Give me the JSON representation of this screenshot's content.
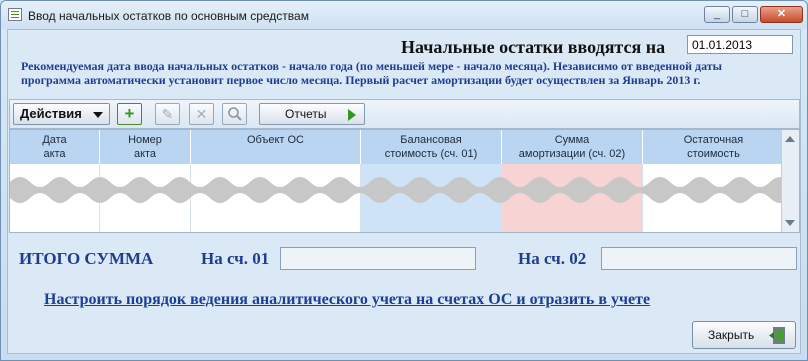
{
  "window": {
    "title": "Ввод начальных остатков по основным средствам",
    "controls": {
      "minimize": "_",
      "maximize": "□",
      "close": "✕"
    }
  },
  "header": {
    "start_label": "Начальные остатки вводятся на",
    "start_date": "01.01.2013",
    "note_line1": "Рекомендуемая дата ввода начальных остатков - начало года (по меньшей мере - начало месяца). Независимо от введенной даты",
    "note_line2": "программа автоматически установит первое число месяца. Первый расчет амортизации будет осуществлен за Январь 2013 г."
  },
  "toolbar": {
    "actions_label": "Действия",
    "add_icon": "plus-icon",
    "edit_icon": "pencil-icon",
    "delete_icon": "x-icon",
    "search_icon": "magnifier-icon",
    "reports_label": "Отчеты"
  },
  "table": {
    "columns": [
      {
        "line1": "Дата",
        "line2": "акта"
      },
      {
        "line1": "Номер",
        "line2": "акта"
      },
      {
        "line1": "Объект ОС",
        "line2": ""
      },
      {
        "line1": "Балансовая",
        "line2": "стоимость (сч. 01)"
      },
      {
        "line1": "Сумма",
        "line2": "амортизации (сч. 02)"
      },
      {
        "line1": "Остаточная",
        "line2": "стоимость"
      }
    ],
    "rows": []
  },
  "totals": {
    "label": "ИТОГО СУММА",
    "acc01_label": "На сч. 01",
    "acc01_value": "",
    "acc02_label": "На сч. 02",
    "acc02_value": ""
  },
  "links": {
    "setup": "Настроить порядок ведения аналитического учета на счетах ОС и отразить в учете"
  },
  "footer": {
    "close_label": "Закрыть"
  },
  "colors": {
    "balance_column": "#cfe3f8",
    "amortization_column": "#f8d3d3",
    "header_bg": "#b9d5f1",
    "link": "#1a3f95"
  }
}
